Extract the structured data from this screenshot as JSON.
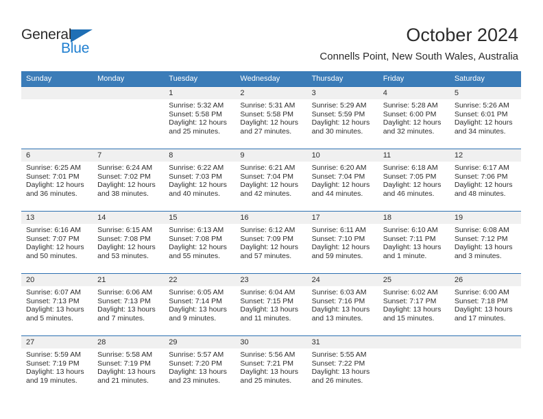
{
  "brand": {
    "name_part1": "General",
    "name_part2": "Blue",
    "triangle_color": "#1f6fb5",
    "blue_color": "#1f7fd0"
  },
  "header": {
    "title": "October 2024",
    "location": "Connells Point, New South Wales, Australia"
  },
  "theme": {
    "header_bg": "#3b7cb8",
    "row_border": "#2a6eb0",
    "daynum_band_bg": "#f0f0f0",
    "text": "#2b2b2b"
  },
  "weekday_headers": [
    "Sunday",
    "Monday",
    "Tuesday",
    "Wednesday",
    "Thursday",
    "Friday",
    "Saturday"
  ],
  "weeks": [
    [
      {
        "day": "",
        "sunrise": "",
        "sunset": "",
        "daylight_line1": "",
        "daylight_line2": ""
      },
      {
        "day": "",
        "sunrise": "",
        "sunset": "",
        "daylight_line1": "",
        "daylight_line2": ""
      },
      {
        "day": "1",
        "sunrise": "Sunrise: 5:32 AM",
        "sunset": "Sunset: 5:58 PM",
        "daylight_line1": "Daylight: 12 hours",
        "daylight_line2": "and 25 minutes."
      },
      {
        "day": "2",
        "sunrise": "Sunrise: 5:31 AM",
        "sunset": "Sunset: 5:58 PM",
        "daylight_line1": "Daylight: 12 hours",
        "daylight_line2": "and 27 minutes."
      },
      {
        "day": "3",
        "sunrise": "Sunrise: 5:29 AM",
        "sunset": "Sunset: 5:59 PM",
        "daylight_line1": "Daylight: 12 hours",
        "daylight_line2": "and 30 minutes."
      },
      {
        "day": "4",
        "sunrise": "Sunrise: 5:28 AM",
        "sunset": "Sunset: 6:00 PM",
        "daylight_line1": "Daylight: 12 hours",
        "daylight_line2": "and 32 minutes."
      },
      {
        "day": "5",
        "sunrise": "Sunrise: 5:26 AM",
        "sunset": "Sunset: 6:01 PM",
        "daylight_line1": "Daylight: 12 hours",
        "daylight_line2": "and 34 minutes."
      }
    ],
    [
      {
        "day": "6",
        "sunrise": "Sunrise: 6:25 AM",
        "sunset": "Sunset: 7:01 PM",
        "daylight_line1": "Daylight: 12 hours",
        "daylight_line2": "and 36 minutes."
      },
      {
        "day": "7",
        "sunrise": "Sunrise: 6:24 AM",
        "sunset": "Sunset: 7:02 PM",
        "daylight_line1": "Daylight: 12 hours",
        "daylight_line2": "and 38 minutes."
      },
      {
        "day": "8",
        "sunrise": "Sunrise: 6:22 AM",
        "sunset": "Sunset: 7:03 PM",
        "daylight_line1": "Daylight: 12 hours",
        "daylight_line2": "and 40 minutes."
      },
      {
        "day": "9",
        "sunrise": "Sunrise: 6:21 AM",
        "sunset": "Sunset: 7:04 PM",
        "daylight_line1": "Daylight: 12 hours",
        "daylight_line2": "and 42 minutes."
      },
      {
        "day": "10",
        "sunrise": "Sunrise: 6:20 AM",
        "sunset": "Sunset: 7:04 PM",
        "daylight_line1": "Daylight: 12 hours",
        "daylight_line2": "and 44 minutes."
      },
      {
        "day": "11",
        "sunrise": "Sunrise: 6:18 AM",
        "sunset": "Sunset: 7:05 PM",
        "daylight_line1": "Daylight: 12 hours",
        "daylight_line2": "and 46 minutes."
      },
      {
        "day": "12",
        "sunrise": "Sunrise: 6:17 AM",
        "sunset": "Sunset: 7:06 PM",
        "daylight_line1": "Daylight: 12 hours",
        "daylight_line2": "and 48 minutes."
      }
    ],
    [
      {
        "day": "13",
        "sunrise": "Sunrise: 6:16 AM",
        "sunset": "Sunset: 7:07 PM",
        "daylight_line1": "Daylight: 12 hours",
        "daylight_line2": "and 50 minutes."
      },
      {
        "day": "14",
        "sunrise": "Sunrise: 6:15 AM",
        "sunset": "Sunset: 7:08 PM",
        "daylight_line1": "Daylight: 12 hours",
        "daylight_line2": "and 53 minutes."
      },
      {
        "day": "15",
        "sunrise": "Sunrise: 6:13 AM",
        "sunset": "Sunset: 7:08 PM",
        "daylight_line1": "Daylight: 12 hours",
        "daylight_line2": "and 55 minutes."
      },
      {
        "day": "16",
        "sunrise": "Sunrise: 6:12 AM",
        "sunset": "Sunset: 7:09 PM",
        "daylight_line1": "Daylight: 12 hours",
        "daylight_line2": "and 57 minutes."
      },
      {
        "day": "17",
        "sunrise": "Sunrise: 6:11 AM",
        "sunset": "Sunset: 7:10 PM",
        "daylight_line1": "Daylight: 12 hours",
        "daylight_line2": "and 59 minutes."
      },
      {
        "day": "18",
        "sunrise": "Sunrise: 6:10 AM",
        "sunset": "Sunset: 7:11 PM",
        "daylight_line1": "Daylight: 13 hours",
        "daylight_line2": "and 1 minute."
      },
      {
        "day": "19",
        "sunrise": "Sunrise: 6:08 AM",
        "sunset": "Sunset: 7:12 PM",
        "daylight_line1": "Daylight: 13 hours",
        "daylight_line2": "and 3 minutes."
      }
    ],
    [
      {
        "day": "20",
        "sunrise": "Sunrise: 6:07 AM",
        "sunset": "Sunset: 7:13 PM",
        "daylight_line1": "Daylight: 13 hours",
        "daylight_line2": "and 5 minutes."
      },
      {
        "day": "21",
        "sunrise": "Sunrise: 6:06 AM",
        "sunset": "Sunset: 7:13 PM",
        "daylight_line1": "Daylight: 13 hours",
        "daylight_line2": "and 7 minutes."
      },
      {
        "day": "22",
        "sunrise": "Sunrise: 6:05 AM",
        "sunset": "Sunset: 7:14 PM",
        "daylight_line1": "Daylight: 13 hours",
        "daylight_line2": "and 9 minutes."
      },
      {
        "day": "23",
        "sunrise": "Sunrise: 6:04 AM",
        "sunset": "Sunset: 7:15 PM",
        "daylight_line1": "Daylight: 13 hours",
        "daylight_line2": "and 11 minutes."
      },
      {
        "day": "24",
        "sunrise": "Sunrise: 6:03 AM",
        "sunset": "Sunset: 7:16 PM",
        "daylight_line1": "Daylight: 13 hours",
        "daylight_line2": "and 13 minutes."
      },
      {
        "day": "25",
        "sunrise": "Sunrise: 6:02 AM",
        "sunset": "Sunset: 7:17 PM",
        "daylight_line1": "Daylight: 13 hours",
        "daylight_line2": "and 15 minutes."
      },
      {
        "day": "26",
        "sunrise": "Sunrise: 6:00 AM",
        "sunset": "Sunset: 7:18 PM",
        "daylight_line1": "Daylight: 13 hours",
        "daylight_line2": "and 17 minutes."
      }
    ],
    [
      {
        "day": "27",
        "sunrise": "Sunrise: 5:59 AM",
        "sunset": "Sunset: 7:19 PM",
        "daylight_line1": "Daylight: 13 hours",
        "daylight_line2": "and 19 minutes."
      },
      {
        "day": "28",
        "sunrise": "Sunrise: 5:58 AM",
        "sunset": "Sunset: 7:19 PM",
        "daylight_line1": "Daylight: 13 hours",
        "daylight_line2": "and 21 minutes."
      },
      {
        "day": "29",
        "sunrise": "Sunrise: 5:57 AM",
        "sunset": "Sunset: 7:20 PM",
        "daylight_line1": "Daylight: 13 hours",
        "daylight_line2": "and 23 minutes."
      },
      {
        "day": "30",
        "sunrise": "Sunrise: 5:56 AM",
        "sunset": "Sunset: 7:21 PM",
        "daylight_line1": "Daylight: 13 hours",
        "daylight_line2": "and 25 minutes."
      },
      {
        "day": "31",
        "sunrise": "Sunrise: 5:55 AM",
        "sunset": "Sunset: 7:22 PM",
        "daylight_line1": "Daylight: 13 hours",
        "daylight_line2": "and 26 minutes."
      },
      {
        "day": "",
        "sunrise": "",
        "sunset": "",
        "daylight_line1": "",
        "daylight_line2": ""
      },
      {
        "day": "",
        "sunrise": "",
        "sunset": "",
        "daylight_line1": "",
        "daylight_line2": ""
      }
    ]
  ]
}
